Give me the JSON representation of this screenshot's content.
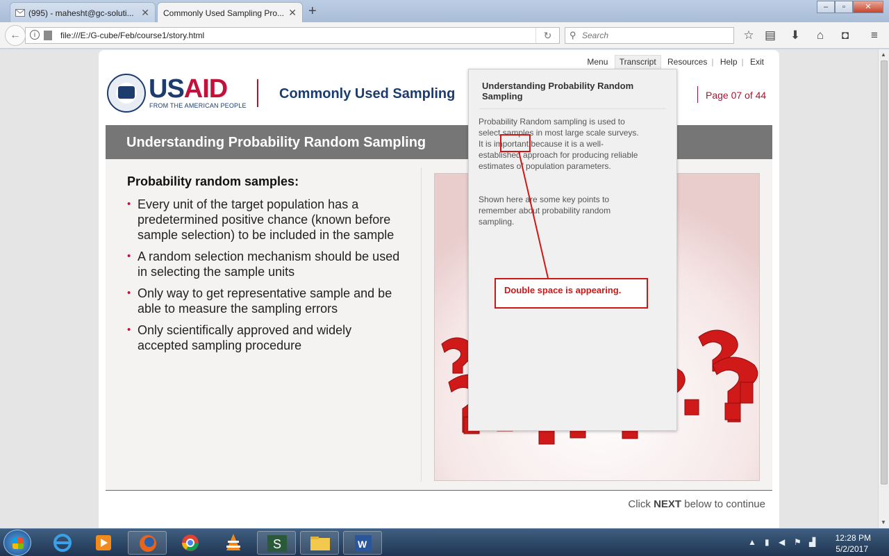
{
  "browser": {
    "tabs": [
      {
        "label": "(995) - mahesht@gc-soluti...",
        "icon": "mail-icon",
        "active": false
      },
      {
        "label": "Commonly Used Sampling Pro...",
        "icon": "page-icon",
        "active": true
      }
    ],
    "new_tab_label": "+",
    "url": "file:///E:/G-cube/Feb/course1/story.html",
    "search_placeholder": "Search"
  },
  "player": {
    "topnav": [
      "Menu",
      "Transcript",
      "Resources",
      "Help",
      "Exit"
    ],
    "active_tab": "Transcript",
    "logo": {
      "us": "US",
      "aid": "AID",
      "tagline": "FROM THE AMERICAN PEOPLE"
    },
    "course_title": "Commonly Used Sampling",
    "page_indicator": "Page 07 of  44",
    "slide_title": "Understanding Probability Random Sampling",
    "content_heading": "Probability random samples:",
    "bullets": [
      "Every unit of the target population has a predetermined positive chance (known before sample selection) to be included in the sample",
      "A random selection mechanism should be used in selecting the sample units",
      "Only way to get representative sample and be able to measure the sampling errors",
      "Only scientifically approved and widely accepted sampling procedure"
    ],
    "footer": {
      "prefix": "Click ",
      "bold": "NEXT",
      "suffix": " below to continue"
    }
  },
  "transcript": {
    "title": "Understanding Probability Random Sampling",
    "paragraphs": [
      "Probability Random sampling is used to select samples in most large scale surveys.  It is important because it is a well-established approach for producing reliable estimates of population parameters.",
      "Shown here are some key points to remember about probability random sampling."
    ]
  },
  "annotation": {
    "label": "Double space is appearing."
  },
  "taskbar": {
    "apps": [
      "internet-explorer",
      "media-player",
      "firefox",
      "chrome",
      "vlc",
      "terminal",
      "file-explorer",
      "word"
    ],
    "time": "12:28 PM",
    "date": "5/2/2017"
  },
  "colors": {
    "brand_red": "#c2113a",
    "brand_blue": "#1d3c6e",
    "title_bar": "#767676",
    "annotation_red": "#d01515"
  }
}
